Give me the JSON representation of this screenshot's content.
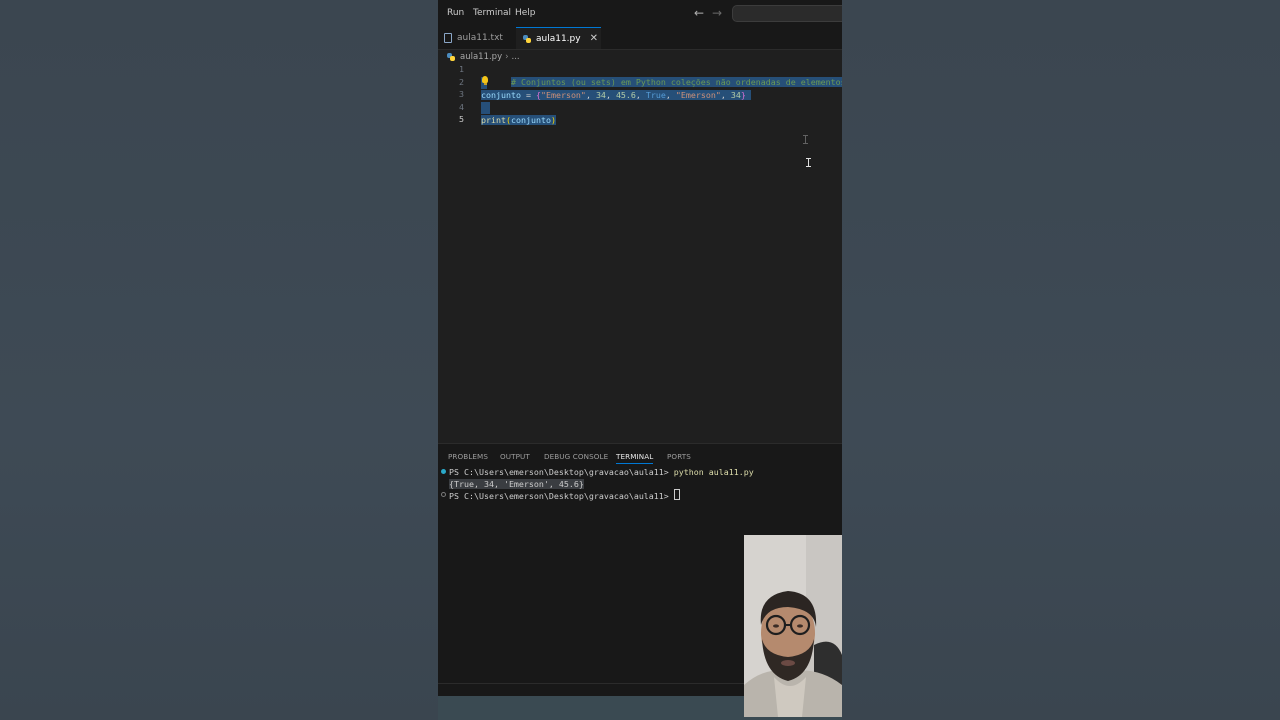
{
  "menu": {
    "items": [
      "Run",
      "Terminal",
      "Help"
    ]
  },
  "tabs": [
    {
      "label": "aula11.txt",
      "icon": "text-file-icon",
      "active": false
    },
    {
      "label": "aula11.py",
      "icon": "python-file-icon",
      "active": true
    }
  ],
  "breadcrumb": {
    "file": "aula11.py",
    "ellipsis": "..."
  },
  "editor": {
    "line_numbers": [
      "1",
      "2",
      "3",
      "4",
      "5"
    ],
    "current_line": 5,
    "lines": [
      "# Conjuntos (ou sets) em Python coleções não ordenadas de elementos úni",
      "",
      "conjunto = {\"Emerson\", 34, 45.6, True, \"Emerson\", 34}",
      "",
      "print(conjunto)"
    ],
    "tokens": {
      "comment": "# Conjuntos (ou sets) em Python coleções não ordenadas de elementos úni",
      "var": "conjunto",
      "assign": " = ",
      "brace_open": "{",
      "str1": "\"Emerson\"",
      "sep1": ", ",
      "num1": "34",
      "sep2": ", ",
      "num2": "45.6",
      "sep3": ", ",
      "kw_true": "True",
      "sep4": ", ",
      "str2": "\"Emerson\"",
      "sep5": ", ",
      "num3": "34",
      "brace_close": "}",
      "fn_print": "print",
      "paren_open": "(",
      "arg": "conjunto",
      "paren_close": ")"
    }
  },
  "panel": {
    "tabs": [
      "PROBLEMS",
      "OUTPUT",
      "DEBUG CONSOLE",
      "TERMINAL",
      "PORTS"
    ],
    "active_tab": "TERMINAL",
    "terminal": {
      "prompt1": "PS C:\\Users\\emerson\\Desktop\\gravacao\\aula11> ",
      "command": "python aula11.py",
      "output": "{True, 34, 'Emerson', 45.6}",
      "prompt2": "PS C:\\Users\\emerson\\Desktop\\gravacao\\aula11> "
    }
  },
  "colors": {
    "accent": "#0078d4",
    "selection": "#264f78",
    "editor_bg": "#1f1f1f",
    "outer_bg": "#3d4852"
  }
}
